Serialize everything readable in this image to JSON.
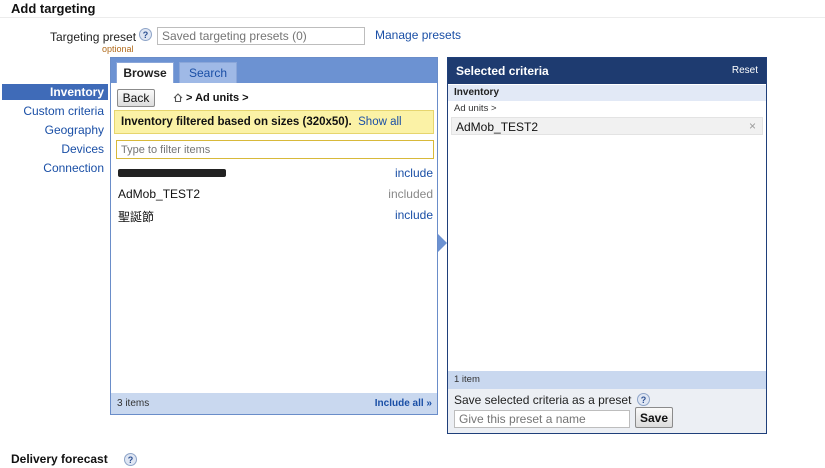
{
  "page": {
    "title": "Add targeting",
    "delivery_forecast": "Delivery forecast"
  },
  "preset": {
    "label": "Targeting preset",
    "optional": "optional",
    "placeholder": "Saved targeting presets (0)",
    "manage": "Manage presets",
    "help_icon": "?"
  },
  "sidebar": {
    "items": [
      {
        "label": "Inventory",
        "active": true
      },
      {
        "label": "Custom criteria"
      },
      {
        "label": "Geography"
      },
      {
        "label": "Devices"
      },
      {
        "label": "Connection"
      }
    ]
  },
  "browse": {
    "tabs": [
      "Browse",
      "Search"
    ],
    "back": "Back",
    "breadcrumb": "> Ad units >",
    "filter_notice": "Inventory filtered based on sizes (320x50).",
    "show_all": "Show all",
    "filter_placeholder": "Type to filter items",
    "items": [
      {
        "name": "",
        "redacted": true,
        "action": "include"
      },
      {
        "name": "AdMob_TEST2",
        "action": "included"
      },
      {
        "name": "聖誕節",
        "action": "include"
      }
    ],
    "count": "3 items",
    "include_all": "Include all »"
  },
  "selected": {
    "title": "Selected criteria",
    "reset": "Reset",
    "category": "Inventory",
    "sub": "Ad units >",
    "item": "AdMob_TEST2",
    "remove": "×",
    "count": "1 item",
    "save_label": "Save selected criteria as a preset",
    "name_placeholder": "Give this preset a name",
    "save_button": "Save"
  },
  "colors": {
    "link": "#1a4fa6",
    "panel_header": "#1e3b70",
    "tab_bar": "#6c92d2",
    "notice_bg": "#fbf2a6"
  }
}
